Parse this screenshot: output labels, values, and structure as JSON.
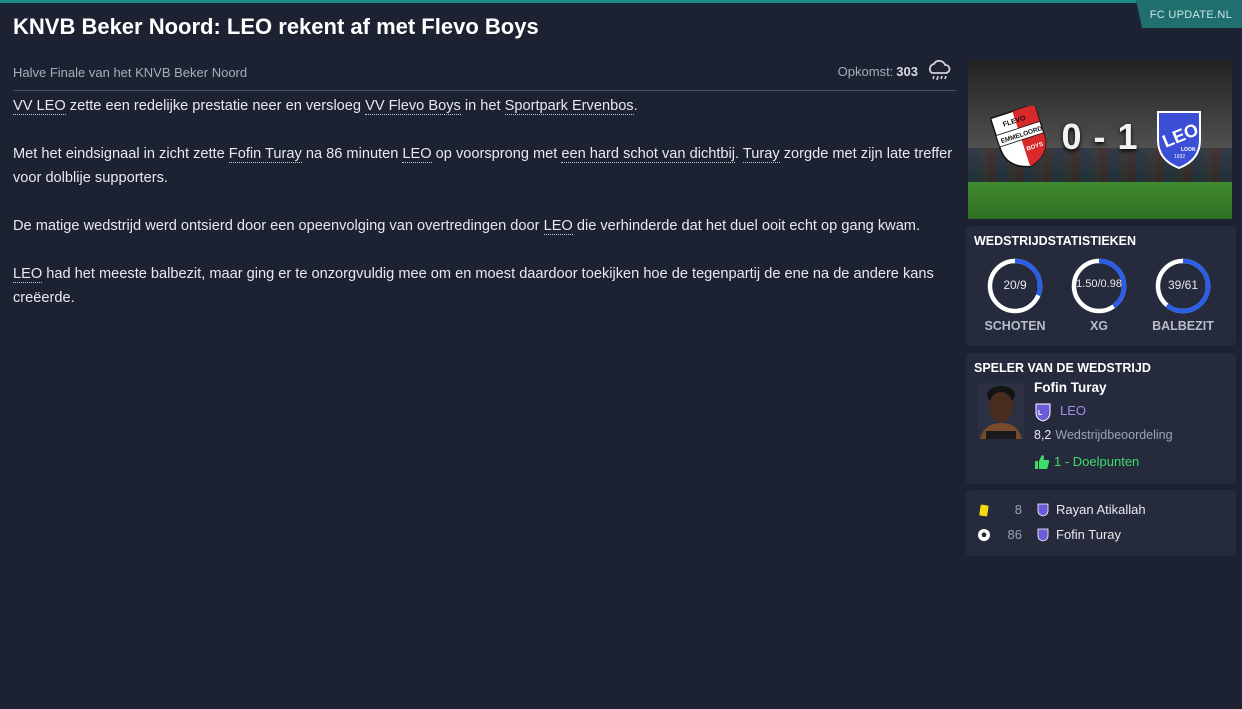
{
  "source_tag": "FC UPDATE.NL",
  "headline": "KNVB Beker Noord: LEO rekent af met Flevo Boys",
  "subtitle": "Halve Finale van het KNVB Beker Noord",
  "attendance": {
    "label": "Opkomst:",
    "value": "303",
    "weather_icon": "rain-cloud-icon"
  },
  "article": {
    "p1": {
      "a": "VV LEO",
      "b": " zette een redelijke prestatie neer en versloeg ",
      "c": "VV Flevo Boys",
      "d": " in het ",
      "e": "Sportpark Ervenbos",
      "f": "."
    },
    "p2": {
      "a": "Met het eindsignaal in zicht zette ",
      "b": "Fofin Turay",
      "c": " na 86 minuten ",
      "d": "LEO",
      "e": " op voorsprong met ",
      "f": "een hard schot van dichtbij",
      "g": ". ",
      "h": "Turay",
      "i": " zorgde met zijn late treffer voor dolblije supporters."
    },
    "p3": {
      "a": "De matige wedstrijd werd ontsierd door een opeenvolging van overtredingen door ",
      "b": "LEO",
      "c": " die verhinderde dat het duel ooit echt op gang kwam."
    },
    "p4": {
      "a": "LEO",
      "b": " had het meeste balbezit, maar ging er te onzorgvuldig mee om en moest daardoor toekijken hoe de tegenpartij de ene na de andere kans creëerde."
    }
  },
  "score": {
    "text": "0 - 1",
    "home": {
      "crest_text_top": "FLEVO",
      "crest_text_mid": "EMMELOORD",
      "crest_text_bottom": "BOYS",
      "colors": [
        "#d8282a",
        "#ffffff"
      ]
    },
    "away": {
      "crest_text_mid": "LEO",
      "crest_text_bottom": "LOON",
      "crest_year": "1932",
      "colors": [
        "#3b4fd6",
        "#ffffff"
      ]
    }
  },
  "match_stats": {
    "title": "WEDSTRIJDSTATISTIEKEN",
    "items": [
      {
        "label": "SCHOTEN",
        "value": "20/9",
        "fraction": 0.31
      },
      {
        "label": "XG",
        "value": "1.50/0.98",
        "fraction": 0.4
      },
      {
        "label": "BALBEZIT",
        "value": "39/61",
        "fraction": 0.61
      }
    ],
    "ring_color": "#2a5ee8",
    "ring_bg": "#ffffff"
  },
  "player_of_match": {
    "title": "SPELER VAN DE WEDSTRIJD",
    "name": "Fofin Turay",
    "club": "LEO",
    "rating": "8,2",
    "rating_label": "Wedstrijdbeoordeling",
    "goals": "1 - Doelpunten"
  },
  "events": [
    {
      "icon": "yellow-card-icon",
      "minute": "8",
      "player": "Rayan Atikallah"
    },
    {
      "icon": "football-icon",
      "minute": "86",
      "player": "Fofin Turay"
    }
  ],
  "colors": {
    "background": "#1d2233",
    "panel": "#252b3c",
    "accent": "#1a8c88",
    "goal_green": "#3fdc6a"
  }
}
